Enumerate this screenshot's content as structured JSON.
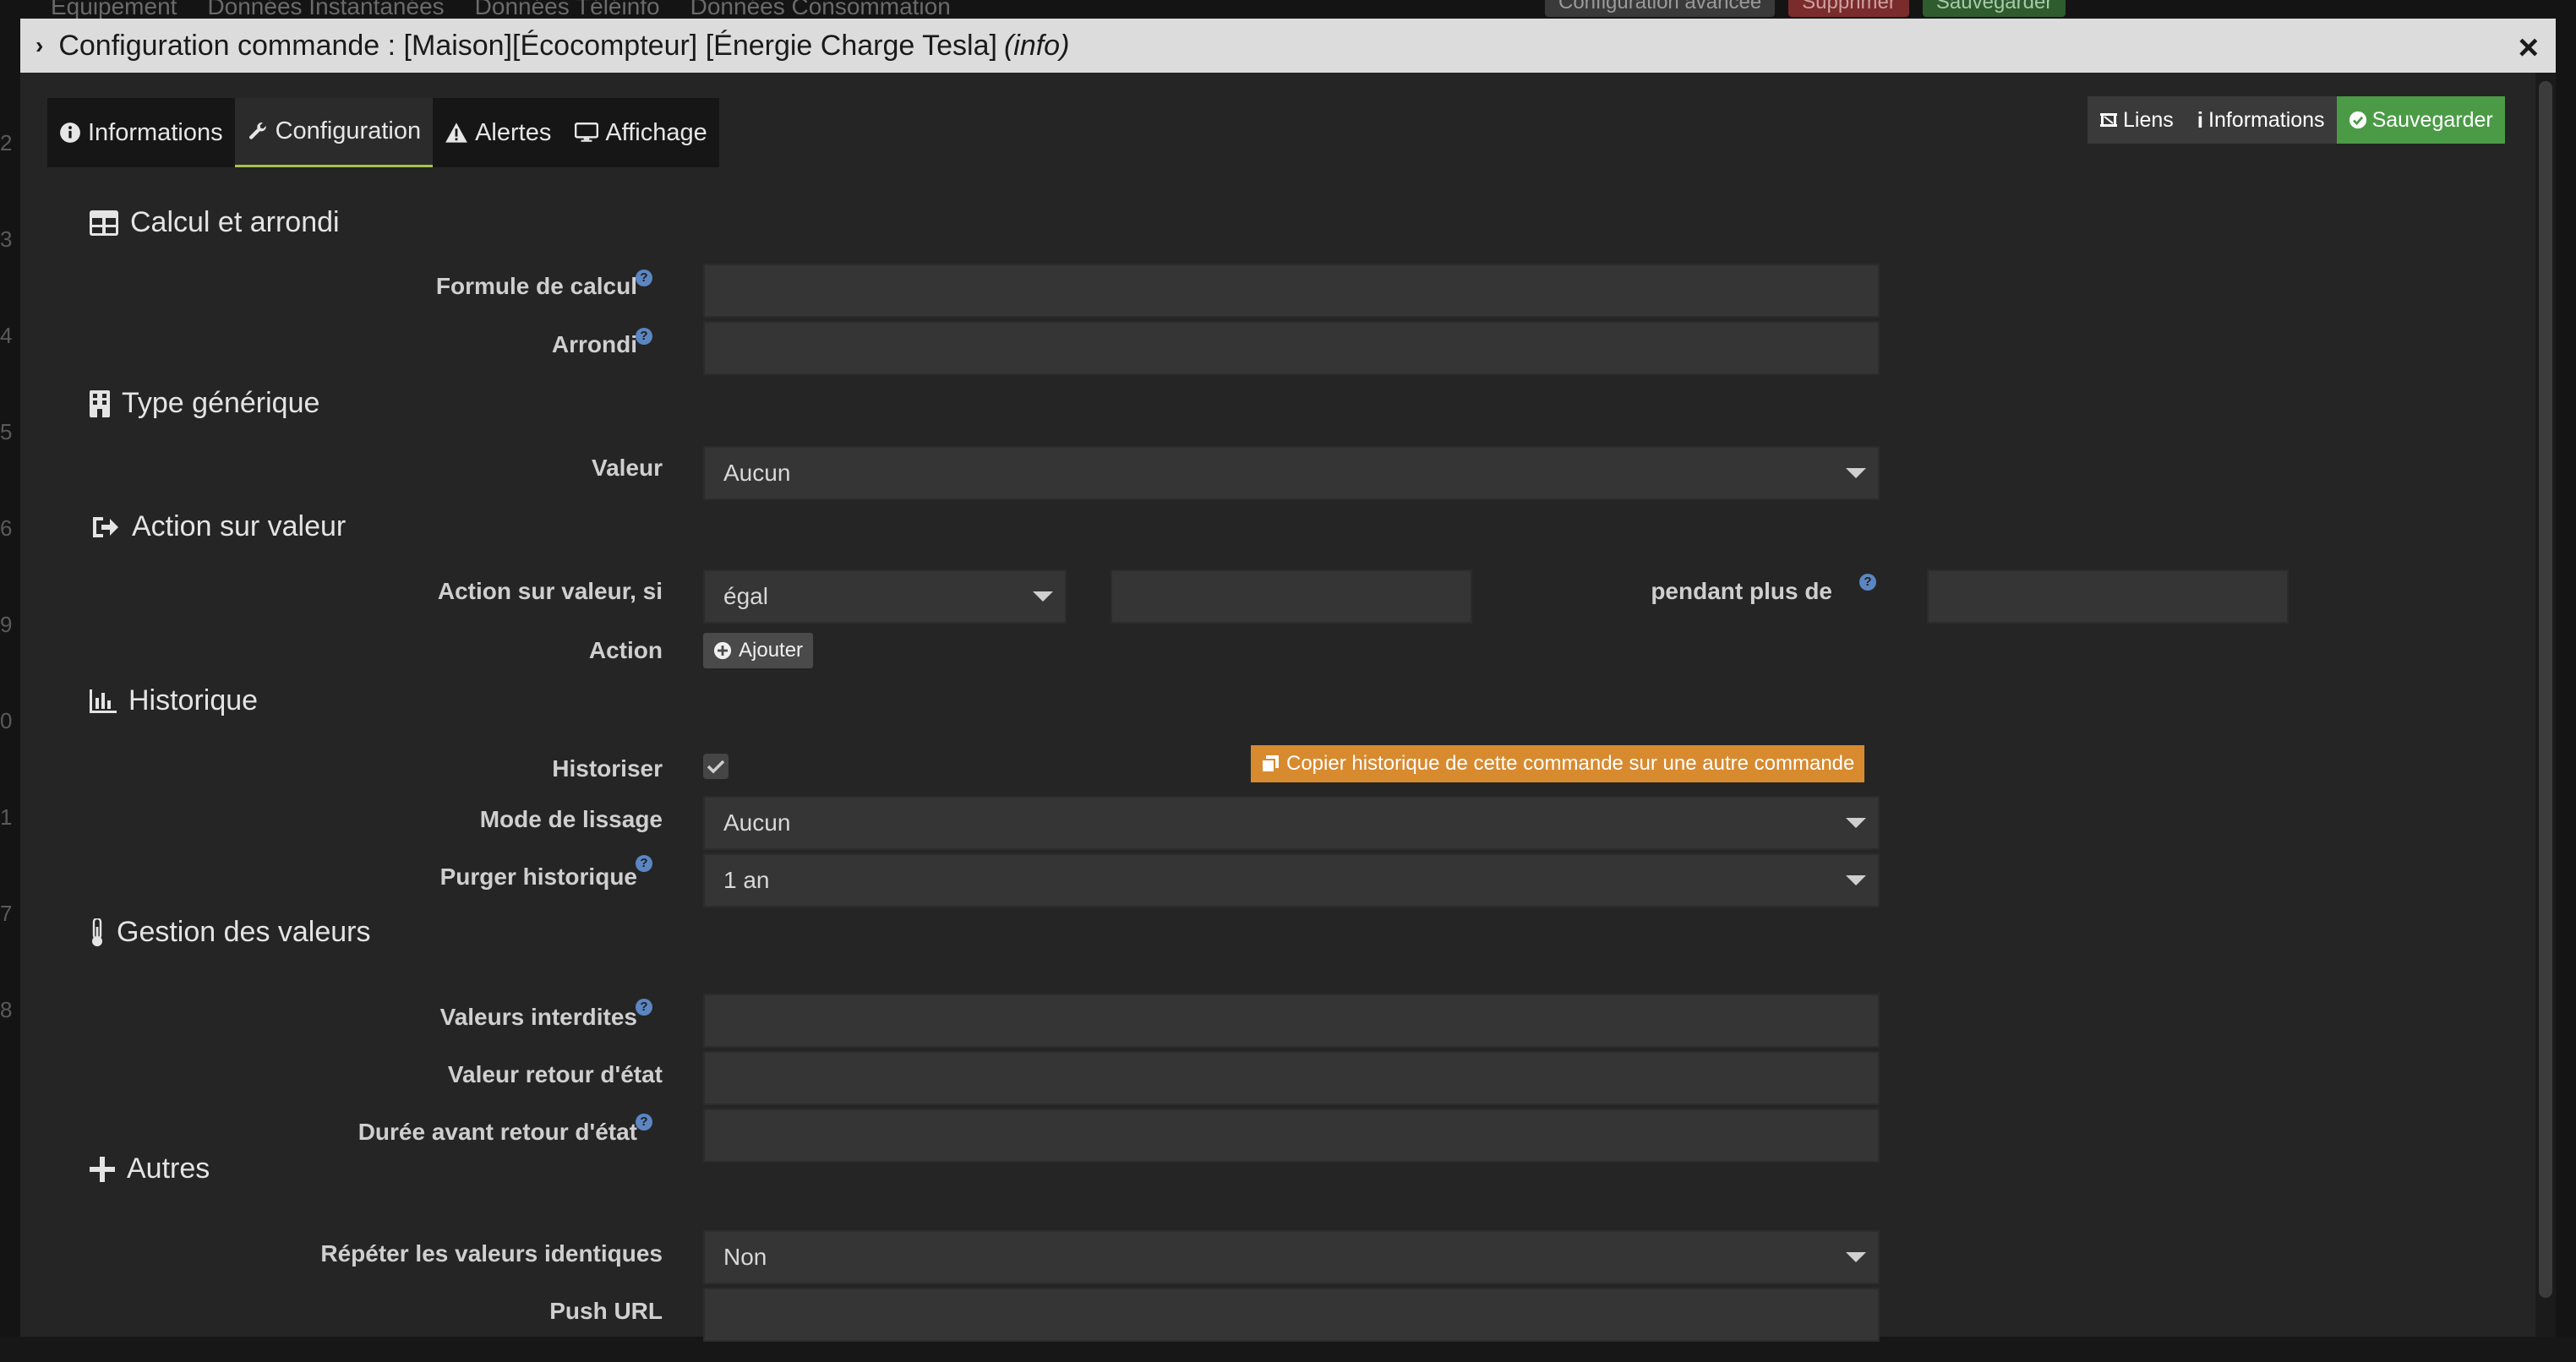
{
  "background": {
    "tabs": [
      "Équipement",
      "Données Instantanées",
      "Données Téléinfo",
      "Données Consommation"
    ],
    "actions": {
      "advanced": "Configuration avancée",
      "delete": "Supprimer",
      "save": "Sauvegarder"
    },
    "row_numbers": [
      "2",
      "3",
      "4",
      "5",
      "6",
      "9",
      "0",
      "1",
      "7",
      "8"
    ]
  },
  "modal": {
    "title": "Configuration commande : [Maison][Écocompteur] [Énergie Charge Tesla]",
    "title_suffix": "(info)",
    "close": "×"
  },
  "tabs": [
    {
      "label": "Informations",
      "icon": "info-circle-icon"
    },
    {
      "label": "Configuration",
      "icon": "wrench-icon",
      "active": true
    },
    {
      "label": "Alertes",
      "icon": "warning-icon"
    },
    {
      "label": "Affichage",
      "icon": "desktop-icon"
    }
  ],
  "top_actions": {
    "links": "Liens",
    "informations": "Informations",
    "save": "Sauvegarder"
  },
  "sections": {
    "calcul": {
      "title": "Calcul et arrondi",
      "formula_label": "Formule de calcul",
      "formula_value": "",
      "round_label": "Arrondi",
      "round_value": ""
    },
    "generic": {
      "title": "Type générique",
      "value_label": "Valeur",
      "value_selected": "Aucun"
    },
    "action": {
      "title": "Action sur valeur",
      "condition_label": "Action sur valeur, si",
      "operator_selected": "égal",
      "compare_value": "",
      "duration_label": "pendant plus de",
      "duration_value": "",
      "action_label": "Action",
      "add_button": "Ajouter"
    },
    "history": {
      "title": "Historique",
      "historize_label": "Historiser",
      "historize_checked": true,
      "copy_button": "Copier historique de cette commande sur une autre commande",
      "smoothing_label": "Mode de lissage",
      "smoothing_selected": "Aucun",
      "purge_label": "Purger historique",
      "purge_selected": "1 an"
    },
    "values": {
      "title": "Gestion des valeurs",
      "forbidden_label": "Valeurs interdites",
      "forbidden_value": "",
      "return_label": "Valeur retour d'état",
      "return_value": "",
      "delay_label": "Durée avant retour d'état",
      "delay_value": ""
    },
    "others": {
      "title": "Autres",
      "repeat_label": "Répéter les valeurs identiques",
      "repeat_selected": "Non",
      "push_label": "Push URL",
      "push_value": ""
    }
  },
  "colors": {
    "accent": "#a7c24a",
    "save_green": "#4b9b46",
    "copy_orange": "#d88a2f",
    "help_blue": "#5b86c2"
  }
}
